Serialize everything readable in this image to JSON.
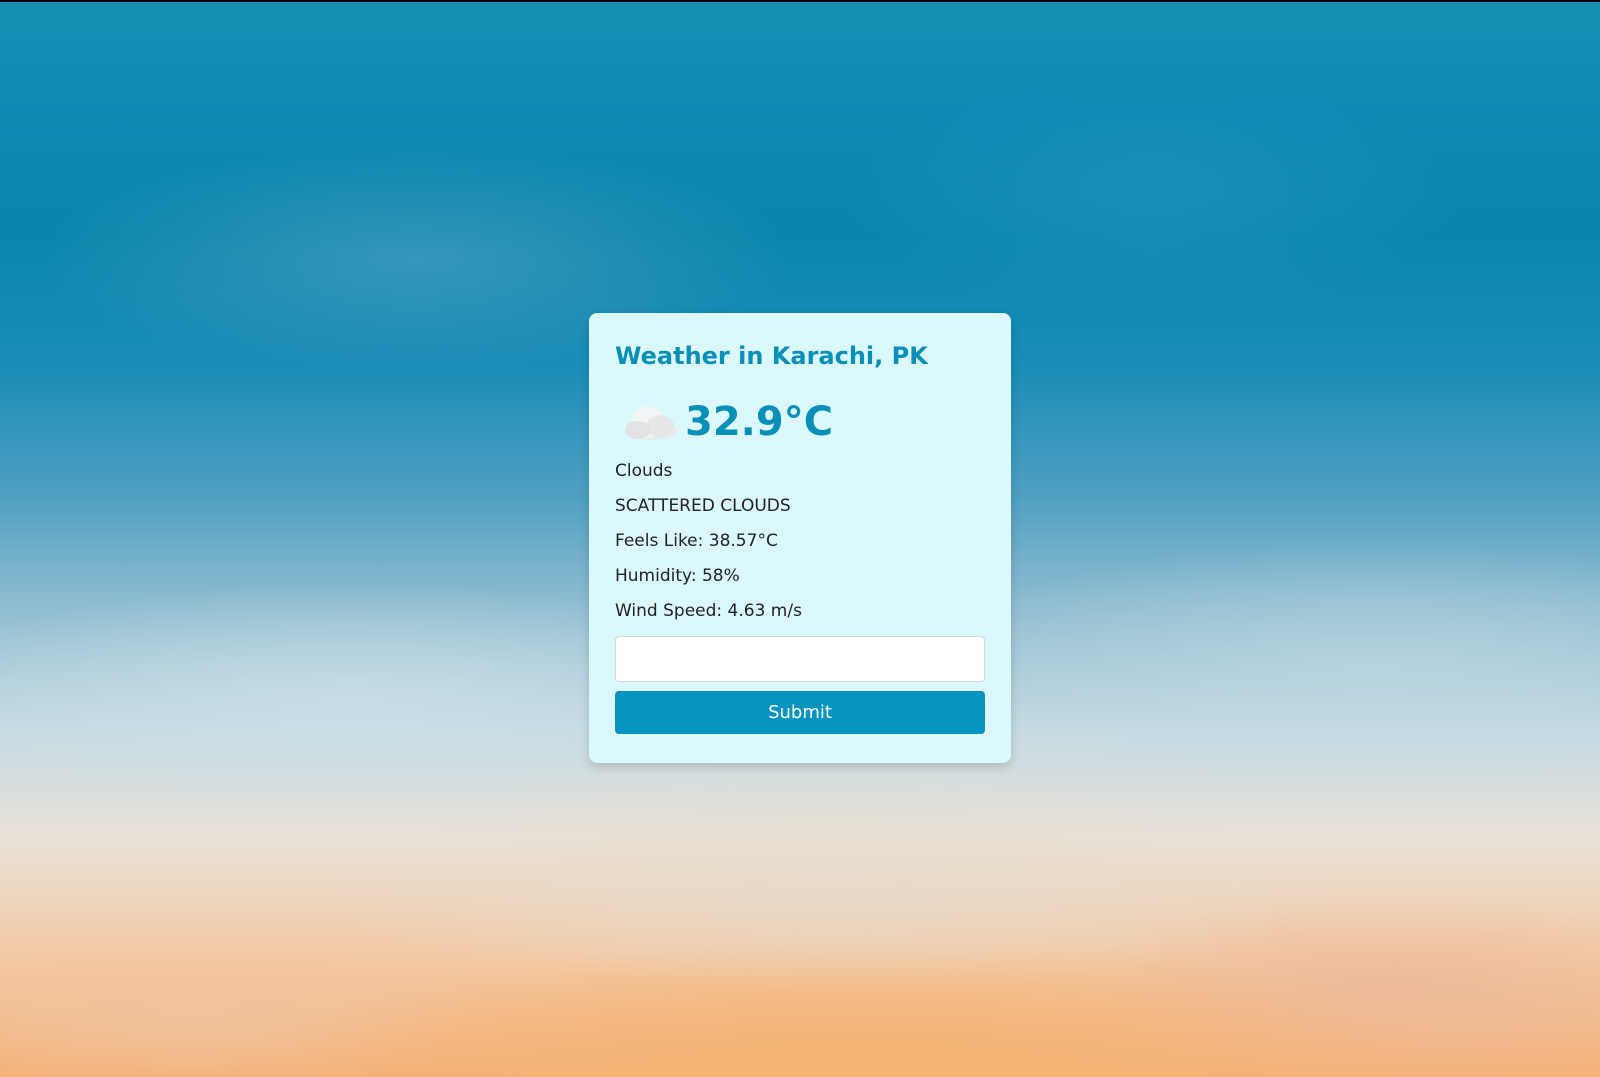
{
  "weather": {
    "title": "Weather in Karachi, PK",
    "temperature": "32.9°C",
    "icon": "cloud-icon",
    "condition": "Clouds",
    "description": "SCATTERED CLOUDS",
    "feels_like": "Feels Like: 38.57°C",
    "humidity": "Humidity: 58%",
    "wind_speed": "Wind Speed: 4.63 m/s"
  },
  "form": {
    "input_value": "",
    "input_placeholder": "",
    "submit_label": "Submit"
  },
  "colors": {
    "card_background": "#dbf8fc",
    "accent": "#0a8fb8",
    "button": "#0593bf",
    "text": "#222222"
  }
}
